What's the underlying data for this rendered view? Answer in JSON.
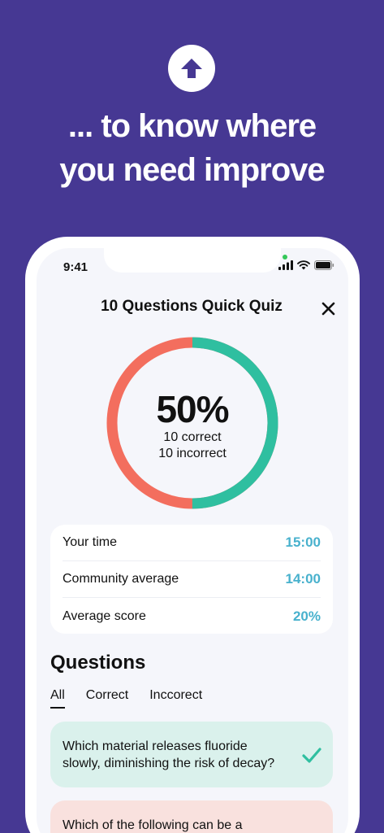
{
  "promo": {
    "icon": "arrow-up-icon",
    "title_line1": "... to know where",
    "title_line2": "you need improve"
  },
  "status_bar": {
    "time": "9:41",
    "icons": [
      "cellular-signal-icon",
      "wifi-icon",
      "battery-icon"
    ]
  },
  "header": {
    "title": "10 Questions Quick Quiz",
    "close_icon": "close-icon"
  },
  "result": {
    "percent_label": "50%",
    "correct_label": "10 correct",
    "incorrect_label": "10 incorrect",
    "correct_fraction": 0.5,
    "correct_color": "#2fbfa0",
    "incorrect_color": "#f36e5e"
  },
  "stats": [
    {
      "label": "Your time",
      "value": "15:00"
    },
    {
      "label": "Community average",
      "value": "14:00"
    },
    {
      "label": "Average score",
      "value": "20%"
    }
  ],
  "questions": {
    "title": "Questions",
    "tabs": [
      {
        "label": "All",
        "active": true
      },
      {
        "label": "Correct",
        "active": false
      },
      {
        "label": "Inccorect",
        "active": false
      }
    ],
    "items": [
      {
        "text": "Which material releases fluoride slowly, diminishing the risk of decay?",
        "status": "correct",
        "icon": "checkmark-icon"
      },
      {
        "text": "Which of the following can be a",
        "status": "incorrect"
      }
    ]
  },
  "colors": {
    "background": "#463893",
    "accent_teal": "#48b1cd",
    "correct_bg": "#daf1ec",
    "incorrect_bg": "#f9e1de"
  }
}
